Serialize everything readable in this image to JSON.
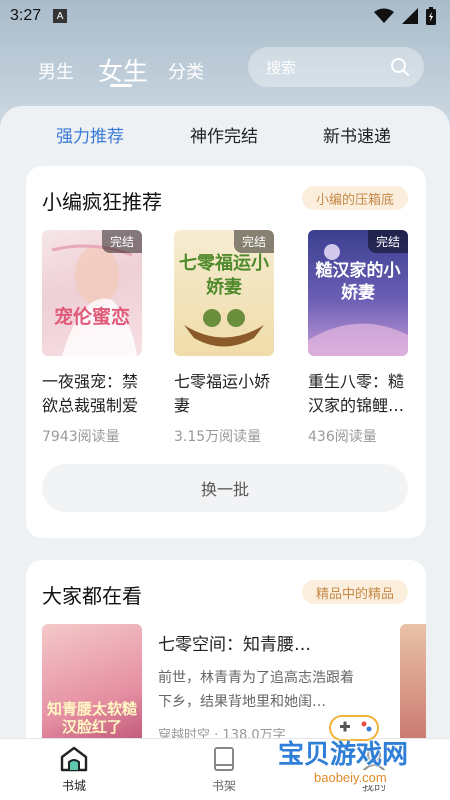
{
  "status": {
    "time": "3:27",
    "a_badge": "A"
  },
  "top_nav": {
    "tabs": [
      "男生",
      "女生",
      "分类"
    ],
    "active": 1,
    "search_placeholder": "搜索"
  },
  "sub_tabs": {
    "items": [
      "强力推荐",
      "神作完结",
      "新书速递"
    ],
    "active": 0
  },
  "section1": {
    "title": "小编疯狂推荐",
    "badge": "小编的压箱底",
    "refresh_label": "换一批",
    "books": [
      {
        "title": "一夜强宠：禁欲总裁强制爱",
        "reads": "7943阅读量",
        "tag": "完结",
        "cover_text": "宠伦蜜恋"
      },
      {
        "title": "七零福运小娇妻",
        "reads": "3.15万阅读量",
        "tag": "完结",
        "cover_text": "七零福运小娇妻"
      },
      {
        "title": "重生八零：糙汉家的锦鲤…",
        "reads": "436阅读量",
        "tag": "完结",
        "cover_text": "糙汉家的小娇妻"
      }
    ]
  },
  "section2": {
    "title": "大家都在看",
    "badge": "精品中的精品",
    "book": {
      "title": "七零空间：知青腰…",
      "desc": "前世，林青青为了追高志浩跟着下乡，结果背地里和她闺…",
      "meta": "穿越时空 · 138.0万字",
      "cover_text": "知青腰太软糙汉脸红了"
    }
  },
  "bottom_nav": {
    "items": [
      "书城",
      "书架",
      "我的"
    ],
    "active": 0
  },
  "watermark": {
    "cn": "宝贝游戏网",
    "url": "baobeiy.com"
  },
  "colors": {
    "accent": "#3a7bd5",
    "badge_bg": "#fbeedd",
    "badge_text": "#c58a48"
  }
}
